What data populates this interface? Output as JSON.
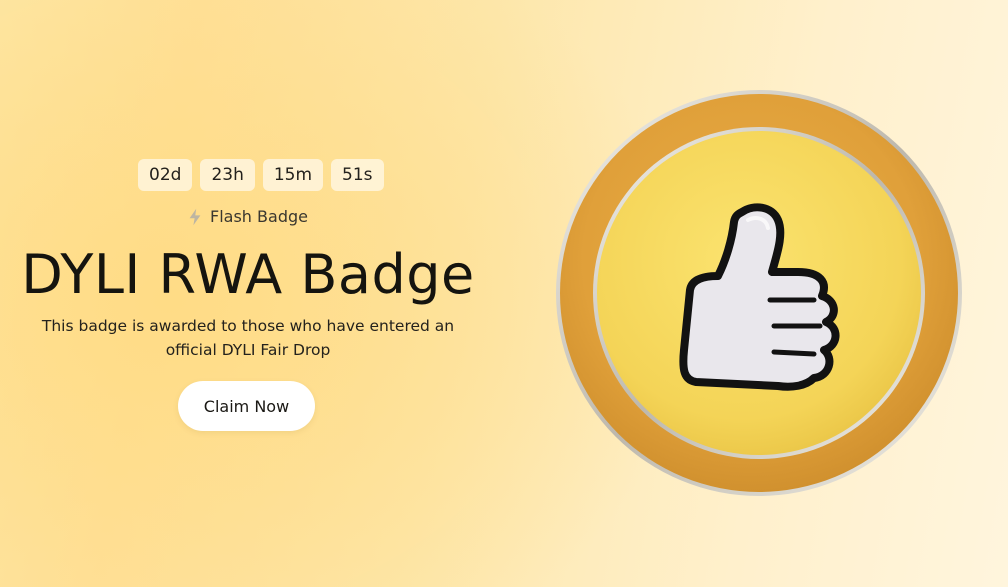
{
  "countdown": {
    "days": "02d",
    "hours": "23h",
    "minutes": "15m",
    "seconds": "51s"
  },
  "badge_type": {
    "icon": "lightning-icon",
    "label": "Flash Badge"
  },
  "title": "DYLI RWA Badge",
  "description": "This badge is awarded to those who have entered an official DYLI Fair Drop",
  "cta_label": "Claim Now",
  "badge_image": {
    "icon": "thumbs-up-icon",
    "colors": {
      "outer_ring": "#e2a43a",
      "inner_face": "#f7d95a",
      "silver_rim": "#d9d6cf",
      "thumb_fill": "#e9e7ec",
      "thumb_outline": "#121212"
    }
  }
}
